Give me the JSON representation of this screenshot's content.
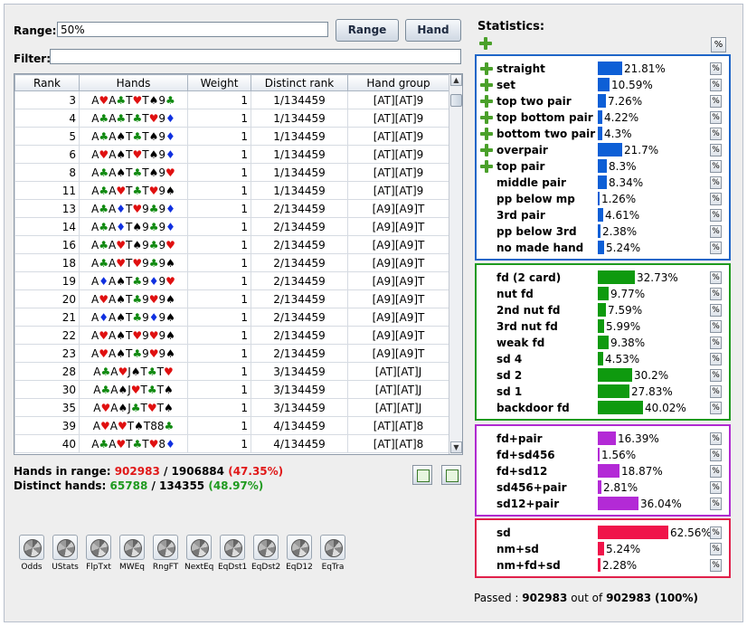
{
  "form": {
    "range_label": "Range:",
    "range_value": "50%",
    "range_button": "Range",
    "hand_button": "Hand",
    "filter_label": "Filter:",
    "filter_value": ""
  },
  "table": {
    "columns": [
      "Rank",
      "Hands",
      "Weight",
      "Distinct rank",
      "Hand group"
    ],
    "rows": [
      {
        "rank": "3",
        "cards": [
          [
            "A",
            "h"
          ],
          [
            "A",
            "c"
          ],
          [
            "T",
            "h"
          ],
          [
            "T",
            "s"
          ],
          [
            "9",
            "c"
          ]
        ],
        "weight": "1",
        "distinct": "1/134459",
        "group": "[AT][AT]9"
      },
      {
        "rank": "4",
        "cards": [
          [
            "A",
            "c"
          ],
          [
            "A",
            "c"
          ],
          [
            "T",
            "c"
          ],
          [
            "T",
            "h"
          ],
          [
            "9",
            "d"
          ]
        ],
        "weight": "1",
        "distinct": "1/134459",
        "group": "[AT][AT]9"
      },
      {
        "rank": "5",
        "cards": [
          [
            "A",
            "c"
          ],
          [
            "A",
            "s"
          ],
          [
            "T",
            "c"
          ],
          [
            "T",
            "s"
          ],
          [
            "9",
            "d"
          ]
        ],
        "weight": "1",
        "distinct": "1/134459",
        "group": "[AT][AT]9"
      },
      {
        "rank": "6",
        "cards": [
          [
            "A",
            "h"
          ],
          [
            "A",
            "s"
          ],
          [
            "T",
            "h"
          ],
          [
            "T",
            "s"
          ],
          [
            "9",
            "d"
          ]
        ],
        "weight": "1",
        "distinct": "1/134459",
        "group": "[AT][AT]9"
      },
      {
        "rank": "8",
        "cards": [
          [
            "A",
            "c"
          ],
          [
            "A",
            "s"
          ],
          [
            "T",
            "c"
          ],
          [
            "T",
            "s"
          ],
          [
            "9",
            "h"
          ]
        ],
        "weight": "1",
        "distinct": "1/134459",
        "group": "[AT][AT]9"
      },
      {
        "rank": "11",
        "cards": [
          [
            "A",
            "c"
          ],
          [
            "A",
            "h"
          ],
          [
            "T",
            "c"
          ],
          [
            "T",
            "h"
          ],
          [
            "9",
            "s"
          ]
        ],
        "weight": "1",
        "distinct": "1/134459",
        "group": "[AT][AT]9"
      },
      {
        "rank": "13",
        "cards": [
          [
            "A",
            "c"
          ],
          [
            "A",
            "d"
          ],
          [
            "T",
            "h"
          ],
          [
            "9",
            "c"
          ],
          [
            "9",
            "d"
          ]
        ],
        "weight": "1",
        "distinct": "2/134459",
        "group": "[A9][A9]T"
      },
      {
        "rank": "14",
        "cards": [
          [
            "A",
            "c"
          ],
          [
            "A",
            "d"
          ],
          [
            "T",
            "s"
          ],
          [
            "9",
            "c"
          ],
          [
            "9",
            "d"
          ]
        ],
        "weight": "1",
        "distinct": "2/134459",
        "group": "[A9][A9]T"
      },
      {
        "rank": "16",
        "cards": [
          [
            "A",
            "c"
          ],
          [
            "A",
            "h"
          ],
          [
            "T",
            "s"
          ],
          [
            "9",
            "c"
          ],
          [
            "9",
            "h"
          ]
        ],
        "weight": "1",
        "distinct": "2/134459",
        "group": "[A9][A9]T"
      },
      {
        "rank": "18",
        "cards": [
          [
            "A",
            "c"
          ],
          [
            "A",
            "h"
          ],
          [
            "T",
            "h"
          ],
          [
            "9",
            "c"
          ],
          [
            "9",
            "s"
          ]
        ],
        "weight": "1",
        "distinct": "2/134459",
        "group": "[A9][A9]T"
      },
      {
        "rank": "19",
        "cards": [
          [
            "A",
            "d"
          ],
          [
            "A",
            "s"
          ],
          [
            "T",
            "c"
          ],
          [
            "9",
            "d"
          ],
          [
            "9",
            "h"
          ]
        ],
        "weight": "1",
        "distinct": "2/134459",
        "group": "[A9][A9]T"
      },
      {
        "rank": "20",
        "cards": [
          [
            "A",
            "h"
          ],
          [
            "A",
            "s"
          ],
          [
            "T",
            "c"
          ],
          [
            "9",
            "h"
          ],
          [
            "9",
            "s"
          ]
        ],
        "weight": "1",
        "distinct": "2/134459",
        "group": "[A9][A9]T"
      },
      {
        "rank": "21",
        "cards": [
          [
            "A",
            "d"
          ],
          [
            "A",
            "s"
          ],
          [
            "T",
            "c"
          ],
          [
            "9",
            "d"
          ],
          [
            "9",
            "s"
          ]
        ],
        "weight": "1",
        "distinct": "2/134459",
        "group": "[A9][A9]T"
      },
      {
        "rank": "22",
        "cards": [
          [
            "A",
            "h"
          ],
          [
            "A",
            "s"
          ],
          [
            "T",
            "h"
          ],
          [
            "9",
            "h"
          ],
          [
            "9",
            "s"
          ]
        ],
        "weight": "1",
        "distinct": "2/134459",
        "group": "[A9][A9]T"
      },
      {
        "rank": "23",
        "cards": [
          [
            "A",
            "h"
          ],
          [
            "A",
            "s"
          ],
          [
            "T",
            "c"
          ],
          [
            "9",
            "h"
          ],
          [
            "9",
            "s"
          ]
        ],
        "weight": "1",
        "distinct": "2/134459",
        "group": "[A9][A9]T"
      },
      {
        "rank": "28",
        "cards": [
          [
            "A",
            "c"
          ],
          [
            "A",
            "h"
          ],
          [
            "J",
            "s"
          ],
          [
            "T",
            "c"
          ],
          [
            "T",
            "h"
          ]
        ],
        "weight": "1",
        "distinct": "3/134459",
        "group": "[AT][AT]J"
      },
      {
        "rank": "30",
        "cards": [
          [
            "A",
            "c"
          ],
          [
            "A",
            "s"
          ],
          [
            "J",
            "h"
          ],
          [
            "T",
            "c"
          ],
          [
            "T",
            "s"
          ]
        ],
        "weight": "1",
        "distinct": "3/134459",
        "group": "[AT][AT]J"
      },
      {
        "rank": "35",
        "cards": [
          [
            "A",
            "h"
          ],
          [
            "A",
            "s"
          ],
          [
            "J",
            "c"
          ],
          [
            "T",
            "h"
          ],
          [
            "T",
            "s"
          ]
        ],
        "weight": "1",
        "distinct": "3/134459",
        "group": "[AT][AT]J"
      },
      {
        "rank": "39",
        "cards": [
          [
            "A",
            "h"
          ],
          [
            "A",
            "h"
          ],
          [
            "T",
            "s"
          ],
          [
            "T",
            "8"
          ],
          [
            "8",
            "c"
          ]
        ],
        "weight": "1",
        "distinct": "4/134459",
        "group": "[AT][AT]8"
      },
      {
        "rank": "40",
        "cards": [
          [
            "A",
            "c"
          ],
          [
            "A",
            "h"
          ],
          [
            "T",
            "c"
          ],
          [
            "T",
            "h"
          ],
          [
            "8",
            "d"
          ]
        ],
        "weight": "1",
        "distinct": "4/134459",
        "group": "[AT][AT]8"
      }
    ]
  },
  "summary": {
    "hands_label": "Hands in range:",
    "hands_count": "902983",
    "hands_total": "/ 1906884",
    "hands_pct": "(47.35%)",
    "distinct_label": "Distinct hands:",
    "distinct_count": "65788",
    "distinct_total": "/ 134355",
    "distinct_pct": "(48.97%)"
  },
  "tools": [
    "Odds",
    "UStats",
    "FlpTxt",
    "MWEq",
    "RngFT",
    "NextEq",
    "EqDst1",
    "EqDst2",
    "EqD12",
    "EqTra"
  ],
  "statistics": {
    "title": "Statistics:",
    "pct_button": "%",
    "groups": [
      {
        "color": "#1f66c8",
        "bar": "#0d5fd6",
        "items": [
          {
            "name": "straight",
            "value": "21.81%",
            "frac": 0.2181,
            "plus": true
          },
          {
            "name": "set",
            "value": "10.59%",
            "frac": 0.1059,
            "plus": true
          },
          {
            "name": "top two pair",
            "value": "7.26%",
            "frac": 0.0726,
            "plus": true
          },
          {
            "name": "top bottom pair",
            "value": "4.22%",
            "frac": 0.0422,
            "plus": true
          },
          {
            "name": "bottom two pair",
            "value": "4.3%",
            "frac": 0.043,
            "plus": true
          },
          {
            "name": "overpair",
            "value": "21.7%",
            "frac": 0.217,
            "plus": true
          },
          {
            "name": "top pair",
            "value": "8.3%",
            "frac": 0.083,
            "plus": true
          },
          {
            "name": "middle pair",
            "value": "8.34%",
            "frac": 0.0834,
            "plus": false
          },
          {
            "name": "pp below mp",
            "value": "1.26%",
            "frac": 0.0126,
            "plus": false
          },
          {
            "name": "3rd pair",
            "value": "4.61%",
            "frac": 0.0461,
            "plus": false
          },
          {
            "name": "pp below 3rd",
            "value": "2.38%",
            "frac": 0.0238,
            "plus": false
          },
          {
            "name": "no made hand",
            "value": "5.24%",
            "frac": 0.0524,
            "plus": false
          }
        ]
      },
      {
        "color": "#1f9a1f",
        "bar": "#0f9a0f",
        "items": [
          {
            "name": "fd (2 card)",
            "value": "32.73%",
            "frac": 0.3273,
            "plus": false
          },
          {
            "name": "nut fd",
            "value": "9.77%",
            "frac": 0.0977,
            "plus": false
          },
          {
            "name": "2nd nut fd",
            "value": "7.59%",
            "frac": 0.0759,
            "plus": false
          },
          {
            "name": "3rd nut fd",
            "value": "5.99%",
            "frac": 0.0599,
            "plus": false
          },
          {
            "name": "weak fd",
            "value": "9.38%",
            "frac": 0.0938,
            "plus": false
          },
          {
            "name": "sd 4",
            "value": "4.53%",
            "frac": 0.0453,
            "plus": false
          },
          {
            "name": "sd 2",
            "value": "30.2%",
            "frac": 0.302,
            "plus": false
          },
          {
            "name": "sd 1",
            "value": "27.83%",
            "frac": 0.2783,
            "plus": false
          },
          {
            "name": "backdoor fd",
            "value": "40.02%",
            "frac": 0.4002,
            "plus": false
          }
        ]
      },
      {
        "color": "#b02ad0",
        "bar": "#b32ad6",
        "items": [
          {
            "name": "fd+pair",
            "value": "16.39%",
            "frac": 0.1639,
            "plus": false
          },
          {
            "name": "fd+sd456",
            "value": "1.56%",
            "frac": 0.0156,
            "plus": false
          },
          {
            "name": "fd+sd12",
            "value": "18.87%",
            "frac": 0.1887,
            "plus": false
          },
          {
            "name": "sd456+pair",
            "value": "2.81%",
            "frac": 0.0281,
            "plus": false
          },
          {
            "name": "sd12+pair",
            "value": "36.04%",
            "frac": 0.3604,
            "plus": false
          }
        ]
      },
      {
        "color": "#e0204a",
        "bar": "#f0144a",
        "items": [
          {
            "name": "sd",
            "value": "62.56%",
            "frac": 0.6256,
            "plus": false
          },
          {
            "name": "nm+sd",
            "value": "5.24%",
            "frac": 0.0524,
            "plus": false
          },
          {
            "name": "nm+fd+sd",
            "value": "2.28%",
            "frac": 0.0228,
            "plus": false
          }
        ]
      }
    ],
    "passed_label": "Passed :",
    "passed_count": "902983",
    "passed_mid": "out of",
    "passed_total": "902983",
    "passed_pct": "(100%)"
  }
}
